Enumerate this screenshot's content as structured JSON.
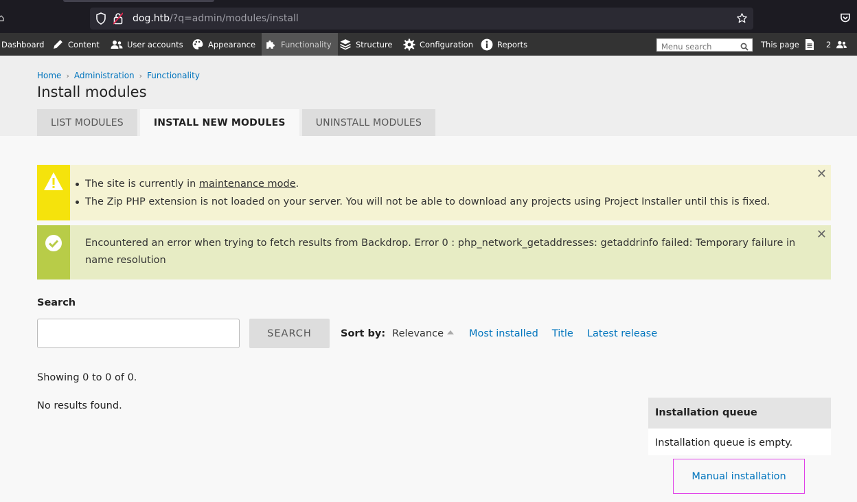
{
  "browser": {
    "url_host": "dog.htb",
    "url_path": "/?q=admin/modules/install"
  },
  "admin_menu": {
    "items": [
      {
        "label": "Dashboard",
        "icon": "dashboard-icon"
      },
      {
        "label": "Content",
        "icon": "pencil-icon"
      },
      {
        "label": "User accounts",
        "icon": "users-icon"
      },
      {
        "label": "Appearance",
        "icon": "palette-icon"
      },
      {
        "label": "Functionality",
        "icon": "puzzle-icon",
        "active": true
      },
      {
        "label": "Structure",
        "icon": "layers-icon"
      },
      {
        "label": "Configuration",
        "icon": "gear-icon"
      },
      {
        "label": "Reports",
        "icon": "info-icon"
      }
    ],
    "search_placeholder": "Menu search",
    "this_page": "This page",
    "user_count": "2"
  },
  "breadcrumb": [
    "Home",
    "Administration",
    "Functionality"
  ],
  "page_title": "Install modules",
  "tabs": [
    {
      "label": "List modules",
      "active": false
    },
    {
      "label": "Install new modules",
      "active": true
    },
    {
      "label": "Uninstall modules",
      "active": false
    }
  ],
  "messages": {
    "warning": {
      "line1_prefix": "The site is currently in ",
      "line1_link": "maintenance mode",
      "line1_suffix": ".",
      "line2": "The Zip PHP extension is not loaded on your server. You will not be able to download any projects using Project Installer until this is fixed."
    },
    "status": {
      "text": "Encountered an error when trying to fetch results from Backdrop. Error 0 : php_network_getaddresses: getaddrinfo failed: Temporary failure in name resolution"
    }
  },
  "search": {
    "label": "Search",
    "value": "",
    "button": "Search",
    "sort_label": "Sort by:",
    "sort_current": "Relevance",
    "sort_options": [
      "Most installed",
      "Title",
      "Latest release"
    ]
  },
  "results": {
    "summary": "Showing 0 to 0 of 0.",
    "empty": "No results found."
  },
  "queue": {
    "title": "Installation queue",
    "empty": "Installation queue is empty.",
    "manual_link": "Manual installation"
  },
  "colors": {
    "link": "#0074bd",
    "toolbar": "#333333",
    "warning_accent": "#f5e30c",
    "status_accent": "#b8cc48"
  }
}
